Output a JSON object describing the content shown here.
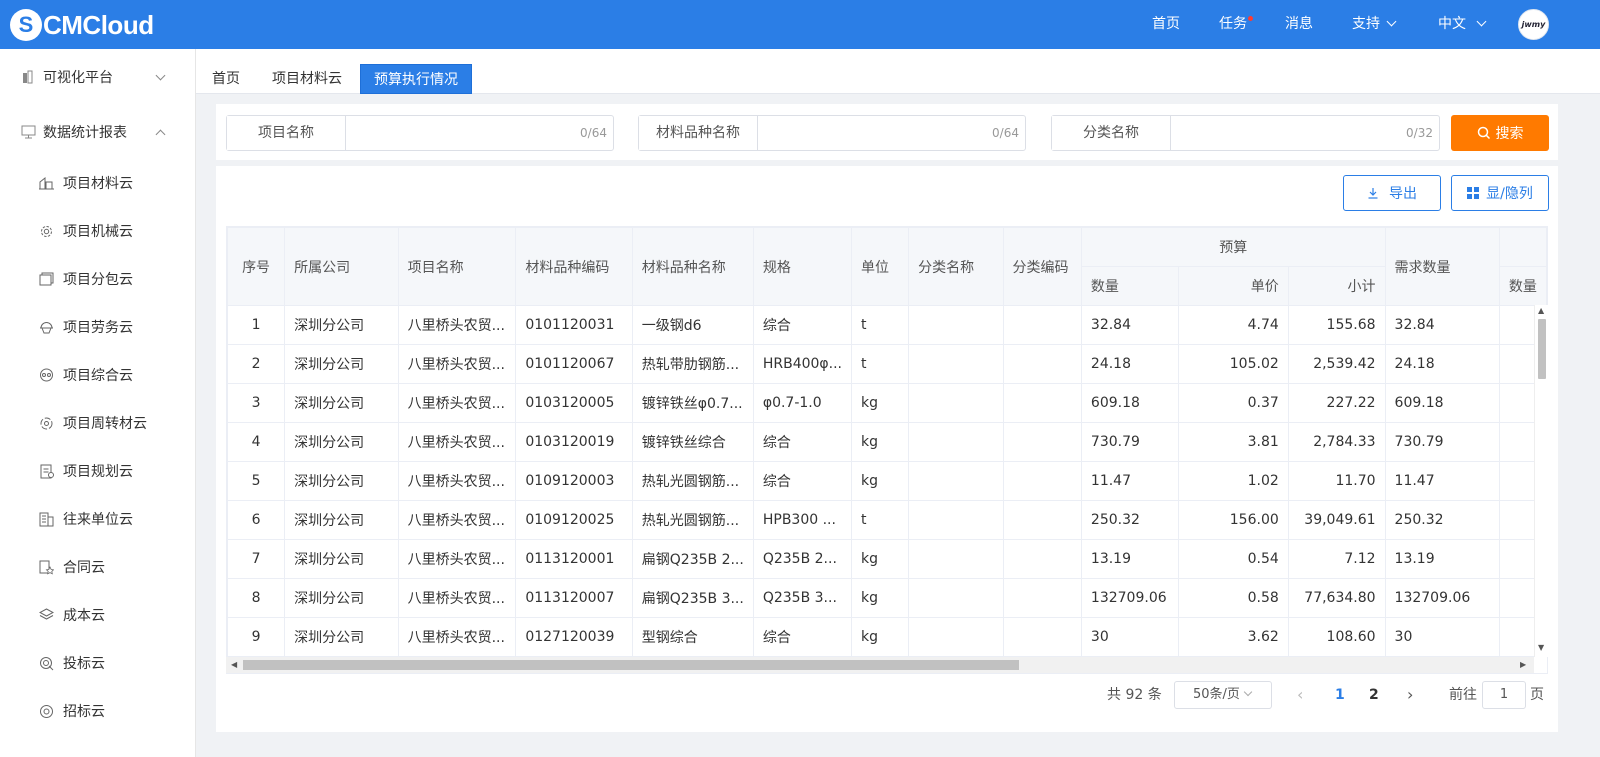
{
  "app": {
    "logo_mark": "S",
    "logo_text": "CMCloud",
    "avatar_text": "jwmy"
  },
  "topnav": {
    "home": "首页",
    "tasks": "任务",
    "messages": "消息",
    "support": "支持",
    "language": "中文"
  },
  "sidebar": {
    "groups": [
      {
        "label": "可视化平台",
        "expanded": false
      },
      {
        "label": "数据统计报表",
        "expanded": true
      }
    ],
    "items": [
      {
        "label": "项目材料云",
        "icon": "building-icon"
      },
      {
        "label": "项目机械云",
        "icon": "gear-icon"
      },
      {
        "label": "项目分包云",
        "icon": "layers-box-icon"
      },
      {
        "label": "项目劳务云",
        "icon": "helmet-icon"
      },
      {
        "label": "项目综合云",
        "icon": "circles-icon"
      },
      {
        "label": "项目周转材云",
        "icon": "cycle-icon"
      },
      {
        "label": "项目规划云",
        "icon": "plan-doc-icon"
      },
      {
        "label": "往来单位云",
        "icon": "office-building-icon"
      },
      {
        "label": "合同云",
        "icon": "contract-star-icon"
      },
      {
        "label": "成本云",
        "icon": "stack-icon"
      },
      {
        "label": "投标云",
        "icon": "bid-target-icon"
      },
      {
        "label": "招标云",
        "icon": "tender-check-icon"
      }
    ]
  },
  "tabs": [
    "首页",
    "项目材料云",
    "预算执行情况"
  ],
  "active_tab": "预算执行情况",
  "filters": [
    {
      "label": "项目名称",
      "value": "",
      "count": "0/64"
    },
    {
      "label": "材料品种名称",
      "value": "",
      "count": "0/64"
    },
    {
      "label": "分类名称",
      "value": "",
      "count": "0/32"
    }
  ],
  "search_label": "搜索",
  "toolbar": {
    "export_label": "导出",
    "columns_label": "显/隐列"
  },
  "table": {
    "headers": {
      "index": "序号",
      "company": "所属公司",
      "project": "项目名称",
      "mat_code": "材料品种编码",
      "mat_name": "材料品种名称",
      "spec": "规格",
      "unit": "单位",
      "cat_name": "分类名称",
      "cat_code": "分类编码",
      "budget_group": "预算",
      "qty": "数量",
      "price": "单价",
      "subtotal": "小计",
      "demand": "需求数量",
      "next": "数量"
    },
    "rows": [
      [
        "1",
        "深圳分公司",
        "八里桥头农贸...",
        "0101120031",
        "一级钢d6",
        "综合",
        "t",
        "",
        "",
        "32.84",
        "4.74",
        "155.68",
        "32.84"
      ],
      [
        "2",
        "深圳分公司",
        "八里桥头农贸...",
        "0101120067",
        "热轧带肋钢筋...",
        "HRB400φ...",
        "t",
        "",
        "",
        "24.18",
        "105.02",
        "2,539.42",
        "24.18"
      ],
      [
        "3",
        "深圳分公司",
        "八里桥头农贸...",
        "0103120005",
        "镀锌铁丝φ0.7...",
        "φ0.7-1.0",
        "kg",
        "",
        "",
        "609.18",
        "0.37",
        "227.22",
        "609.18"
      ],
      [
        "4",
        "深圳分公司",
        "八里桥头农贸...",
        "0103120019",
        "镀锌铁丝综合",
        "综合",
        "kg",
        "",
        "",
        "730.79",
        "3.81",
        "2,784.33",
        "730.79"
      ],
      [
        "5",
        "深圳分公司",
        "八里桥头农贸...",
        "0109120003",
        "热轧光圆钢筋...",
        "综合",
        "kg",
        "",
        "",
        "11.47",
        "1.02",
        "11.70",
        "11.47"
      ],
      [
        "6",
        "深圳分公司",
        "八里桥头农贸...",
        "0109120025",
        "热轧光圆钢筋...",
        "HPB300 ...",
        "t",
        "",
        "",
        "250.32",
        "156.00",
        "39,049.61",
        "250.32"
      ],
      [
        "7",
        "深圳分公司",
        "八里桥头农贸...",
        "0113120001",
        "扁钢Q235B 2...",
        "Q235B 2...",
        "kg",
        "",
        "",
        "13.19",
        "0.54",
        "7.12",
        "13.19"
      ],
      [
        "8",
        "深圳分公司",
        "八里桥头农贸...",
        "0113120007",
        "扁钢Q235B 3...",
        "Q235B 3...",
        "kg",
        "",
        "",
        "132709.06",
        "0.58",
        "77,634.80",
        "132709.06"
      ],
      [
        "9",
        "深圳分公司",
        "八里桥头农贸...",
        "0127120039",
        "型钢综合",
        "综合",
        "kg",
        "",
        "",
        "30",
        "3.62",
        "108.60",
        "30"
      ]
    ]
  },
  "pagination": {
    "total": "共 92 条",
    "page_size": "50条/页",
    "pages": [
      "1",
      "2"
    ],
    "current": "1",
    "goto_label": "前往",
    "goto_value": "1",
    "page_suffix": "页"
  }
}
